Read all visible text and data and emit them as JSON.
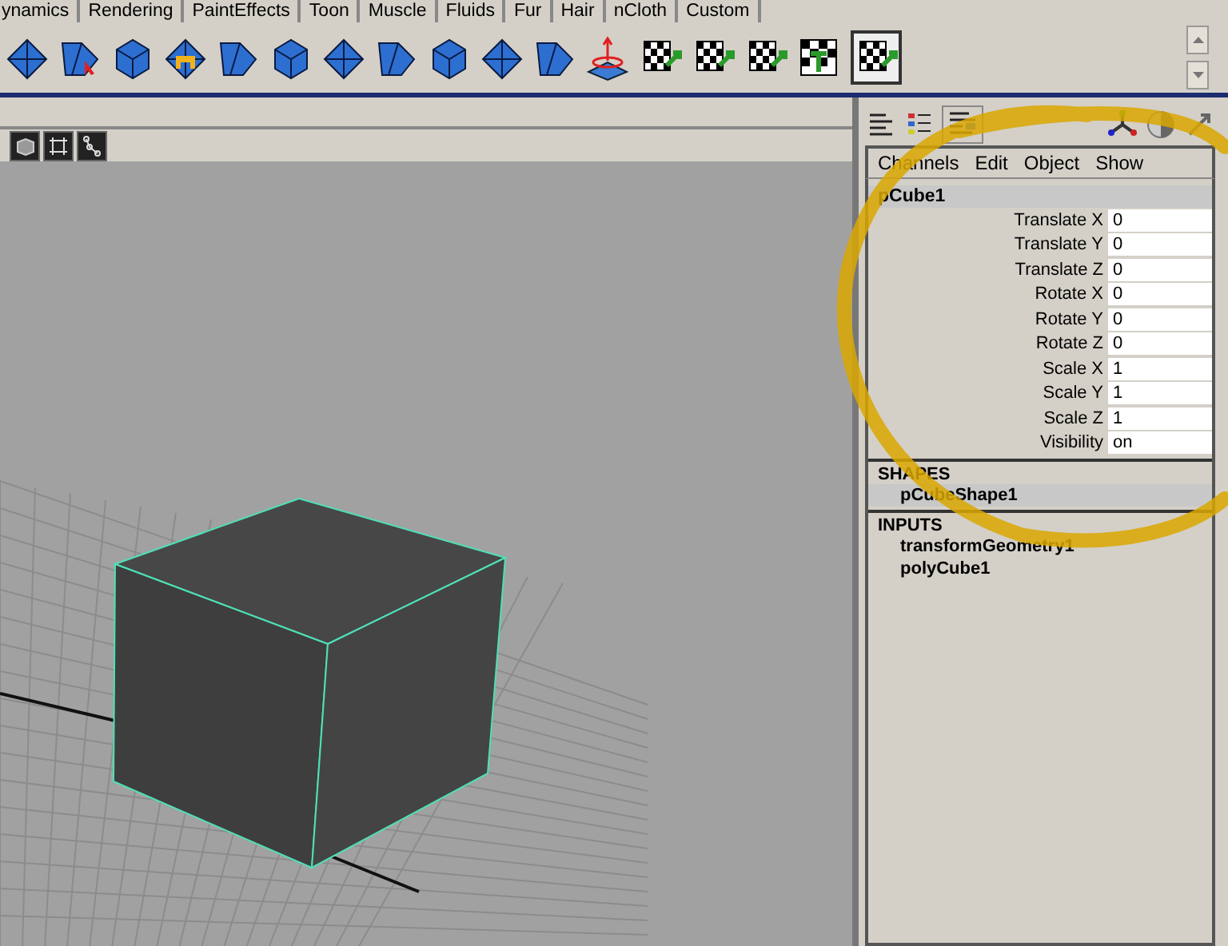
{
  "shelf_tabs": [
    {
      "label": "ynamics"
    },
    {
      "label": "Rendering"
    },
    {
      "label": "PaintEffects"
    },
    {
      "label": "Toon"
    },
    {
      "label": "Muscle"
    },
    {
      "label": "Fluids"
    },
    {
      "label": "Fur"
    },
    {
      "label": "Hair"
    },
    {
      "label": "nCloth"
    },
    {
      "label": "Custom"
    }
  ],
  "channel_box": {
    "menus": [
      "Channels",
      "Edit",
      "Object",
      "Show"
    ],
    "node": "pCube1",
    "attributes": [
      {
        "label": "Translate X",
        "value": "0"
      },
      {
        "label": "Translate Y",
        "value": "0"
      },
      {
        "label": "Translate Z",
        "value": "0"
      },
      {
        "label": "Rotate X",
        "value": "0"
      },
      {
        "label": "Rotate Y",
        "value": "0"
      },
      {
        "label": "Rotate Z",
        "value": "0"
      },
      {
        "label": "Scale X",
        "value": "1"
      },
      {
        "label": "Scale Y",
        "value": "1"
      },
      {
        "label": "Scale Z",
        "value": "1"
      },
      {
        "label": "Visibility",
        "value": "on"
      }
    ],
    "shapes_header": "SHAPES",
    "shapes": [
      {
        "label": "pCubeShape1",
        "selected": true
      }
    ],
    "inputs_header": "INPUTS",
    "inputs": [
      {
        "label": "transformGeometry1",
        "selected": false
      },
      {
        "label": "polyCube1",
        "selected": false
      }
    ]
  }
}
